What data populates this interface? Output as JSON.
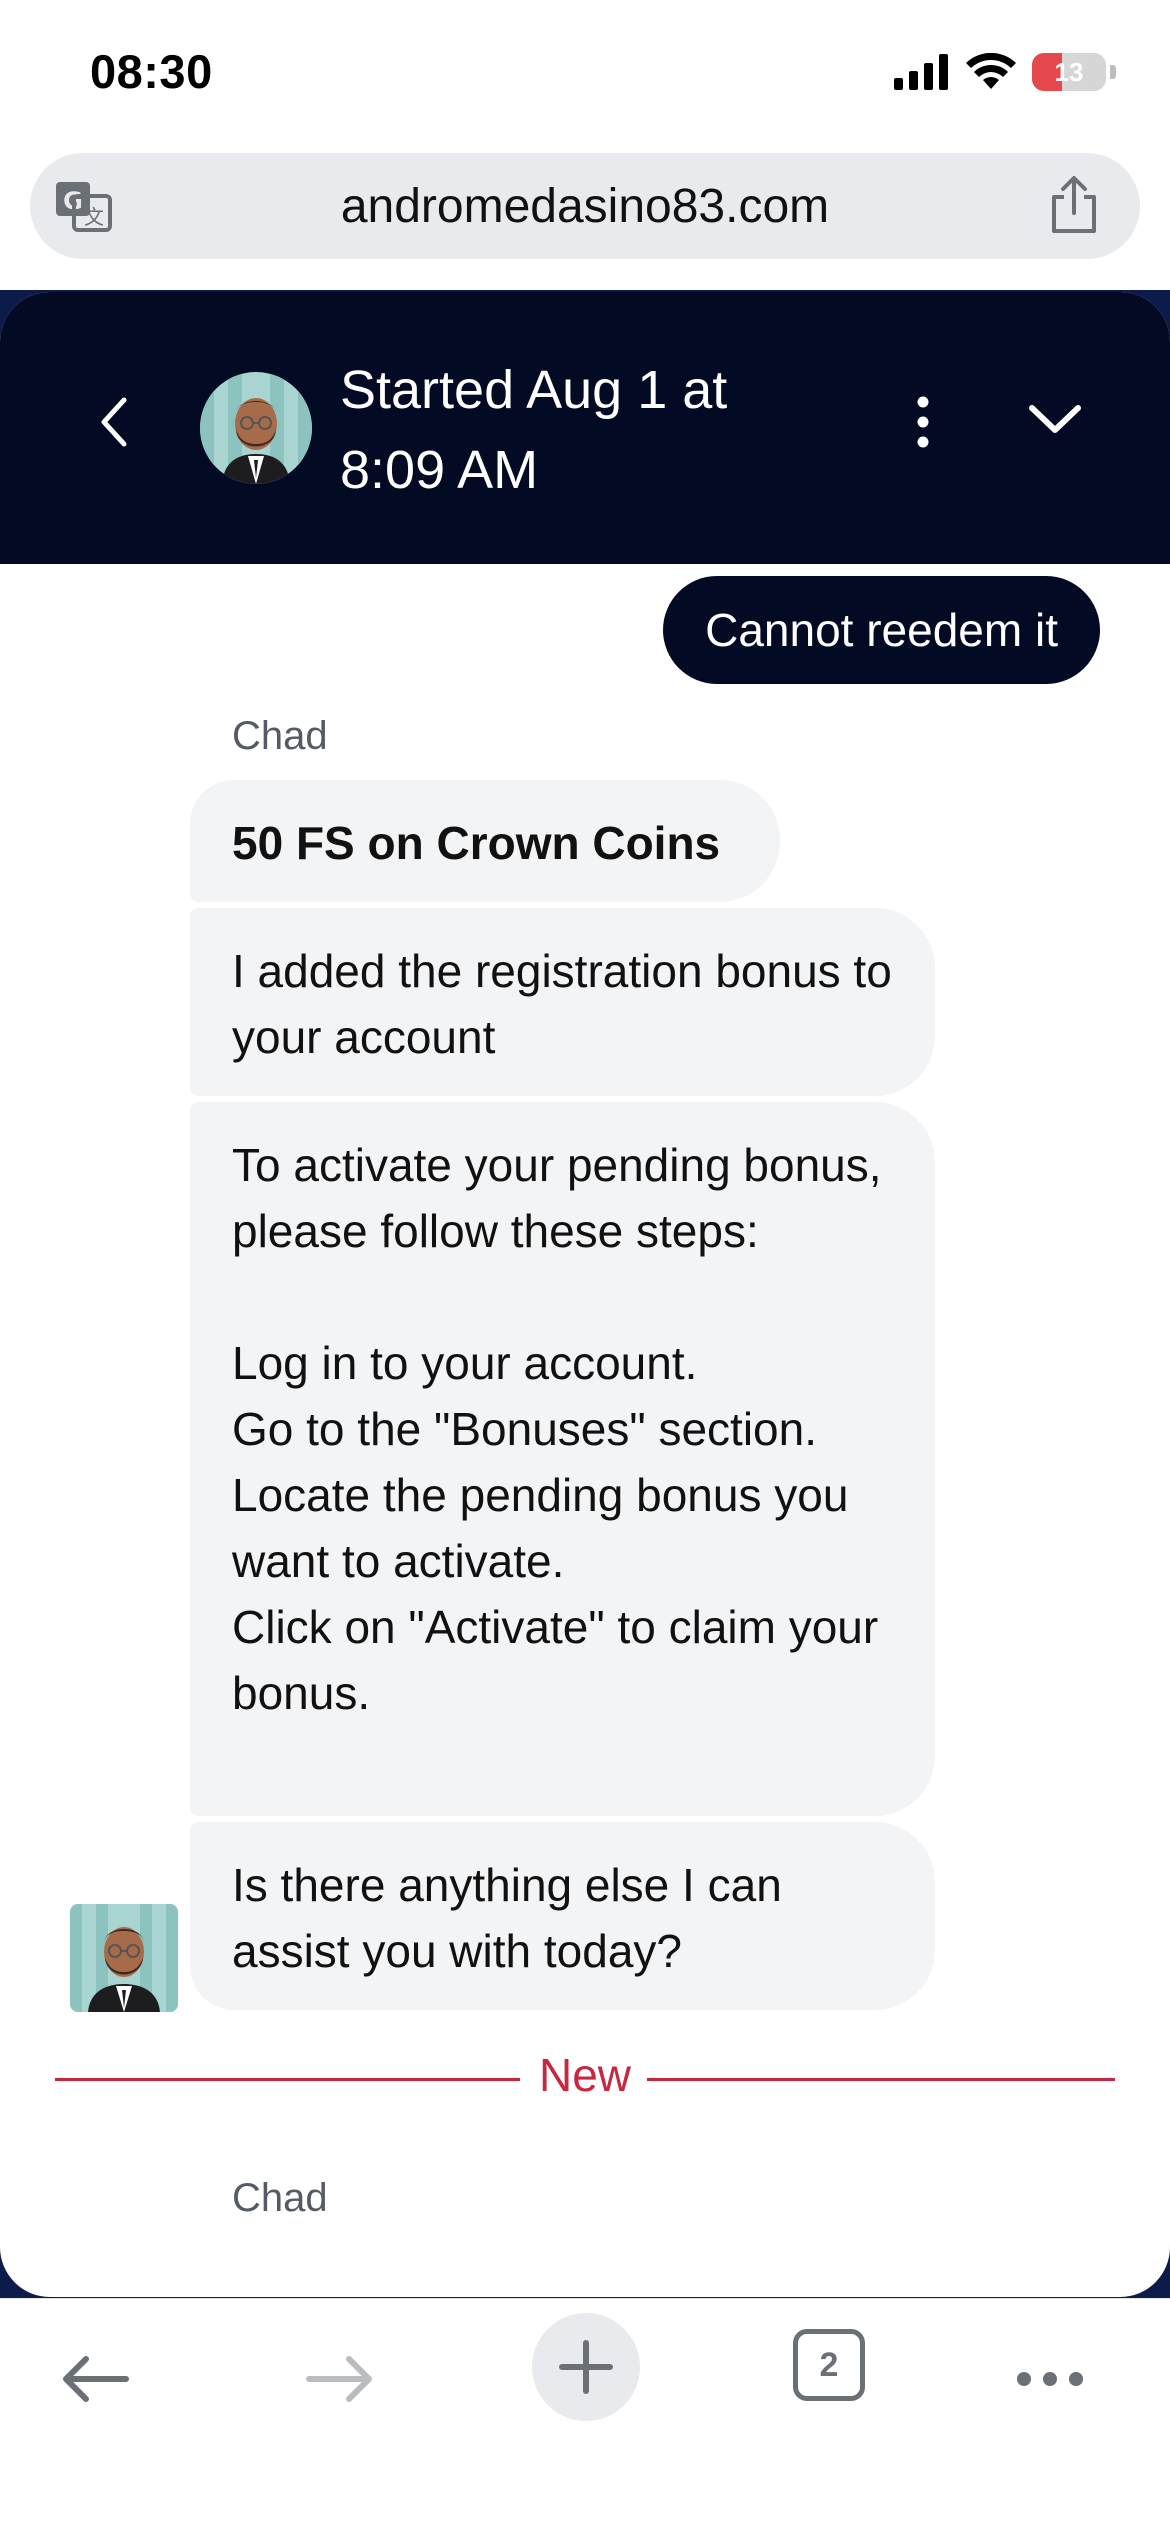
{
  "status_bar": {
    "time": "08:30",
    "battery": "13",
    "icons": [
      "signal-icon",
      "wifi-icon",
      "battery-icon"
    ]
  },
  "browser": {
    "url": "andromedasino83.com",
    "icons": [
      "translate-icon",
      "share-icon"
    ],
    "tab_count": "2",
    "toolbar_icons": [
      "back-arrow-icon",
      "forward-arrow-icon",
      "plus-icon",
      "tabs-icon",
      "more-icon"
    ]
  },
  "chat": {
    "header_title": "Started Aug 1 at 8:09 AM",
    "header_icons": [
      "chevron-left-icon",
      "kebab-menu-icon",
      "chevron-down-icon"
    ],
    "user_message": "Cannot reedem it",
    "agent_name": "Chad",
    "agent_messages": [
      "50 FS on Crown Coins",
      "I added the registration bonus to your account",
      "To activate your pending bonus, please follow these steps:\n\nLog in to your account.\nGo to the \"Bonuses\" section.\nLocate the pending bonus you want to activate.\nClick on \"Activate\" to claim your bonus.",
      "Is there anything else I can assist you with today?"
    ],
    "new_divider_label": "New",
    "next_sender_name": "Chad"
  },
  "colors": {
    "header_bg": "#020a24",
    "user_bubble_bg": "#020a24",
    "bot_bubble_bg": "#f3f4f6",
    "new_divider": "#c8283f",
    "battery_low": "#e5484d"
  }
}
